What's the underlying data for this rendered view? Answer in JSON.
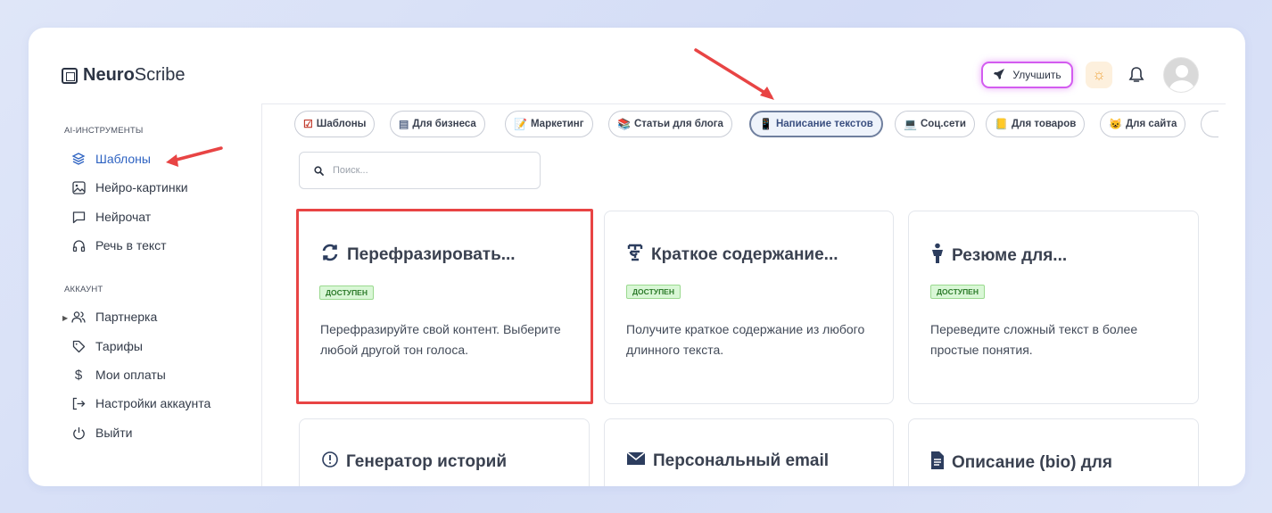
{
  "app": {
    "logo_bold": "Neuro",
    "logo_thin": "Scribe"
  },
  "header": {
    "upgrade_label": "Улучшить",
    "upgrade_icon": "rocket-icon",
    "theme_icon": "sun-icon",
    "notifications_icon": "bell-icon",
    "avatar_icon": "user-avatar"
  },
  "sidebar": {
    "ai_section_title": "AI-ИНСТРУМЕНТЫ",
    "ai_items": [
      {
        "label": "Шаблоны",
        "icon": "layers-icon",
        "active": true
      },
      {
        "label": "Нейро-картинки",
        "icon": "image-icon"
      },
      {
        "label": "Нейрочат",
        "icon": "chat-icon"
      },
      {
        "label": "Речь в текст",
        "icon": "headphones-icon"
      }
    ],
    "account_section_title": "АККАУНТ",
    "account_items": [
      {
        "label": "Партнерка",
        "icon": "users-icon",
        "expandable": true
      },
      {
        "label": "Тарифы",
        "icon": "tag-icon"
      },
      {
        "label": "Мои оплаты",
        "icon": "dollar-icon"
      },
      {
        "label": "Настройки аккаунта",
        "icon": "logout-arrow-icon"
      },
      {
        "label": "Выйти",
        "icon": "power-icon"
      }
    ]
  },
  "categories": [
    {
      "label": "Шаблоны",
      "icon": "☑"
    },
    {
      "label": "Для бизнеса",
      "icon": "▤"
    },
    {
      "label": "Маркетинг",
      "icon": "📝"
    },
    {
      "label": "Статьи для блога",
      "icon": "📚"
    },
    {
      "label": "Написание текстов",
      "icon": "📱",
      "active": true
    },
    {
      "label": "Соц.сети",
      "icon": "💻"
    },
    {
      "label": "Для товаров",
      "icon": "📒"
    },
    {
      "label": "Для сайта",
      "icon": "😺"
    }
  ],
  "search": {
    "placeholder": "Поиск..."
  },
  "cards": [
    {
      "title": "Перефразировать...",
      "icon": "🔄",
      "badge": "ДОСТУПЕН",
      "description": "Перефразируйте свой контент. Выберите любой другой тон голоса.",
      "highlighted": true
    },
    {
      "title": "Краткое содержание...",
      "icon": "📜",
      "badge": "ДОСТУПЕН",
      "description": "Получите краткое содержание из любого длинного текста."
    },
    {
      "title": "Резюме для...",
      "icon": "🚹",
      "badge": "ДОСТУПЕН",
      "description": "Переведите сложный текст в более простые понятия."
    },
    {
      "title": "Генератор историй",
      "icon": "ⓘ"
    },
    {
      "title": "Персональный email",
      "icon": "✉"
    },
    {
      "title": "Описание (bio) для",
      "icon": "📄"
    }
  ],
  "colors": {
    "accent": "#2e63c2",
    "annotation_red": "#e84444",
    "upgrade_glow": "#d35cf0",
    "badge_bg": "#d9f7d6"
  }
}
